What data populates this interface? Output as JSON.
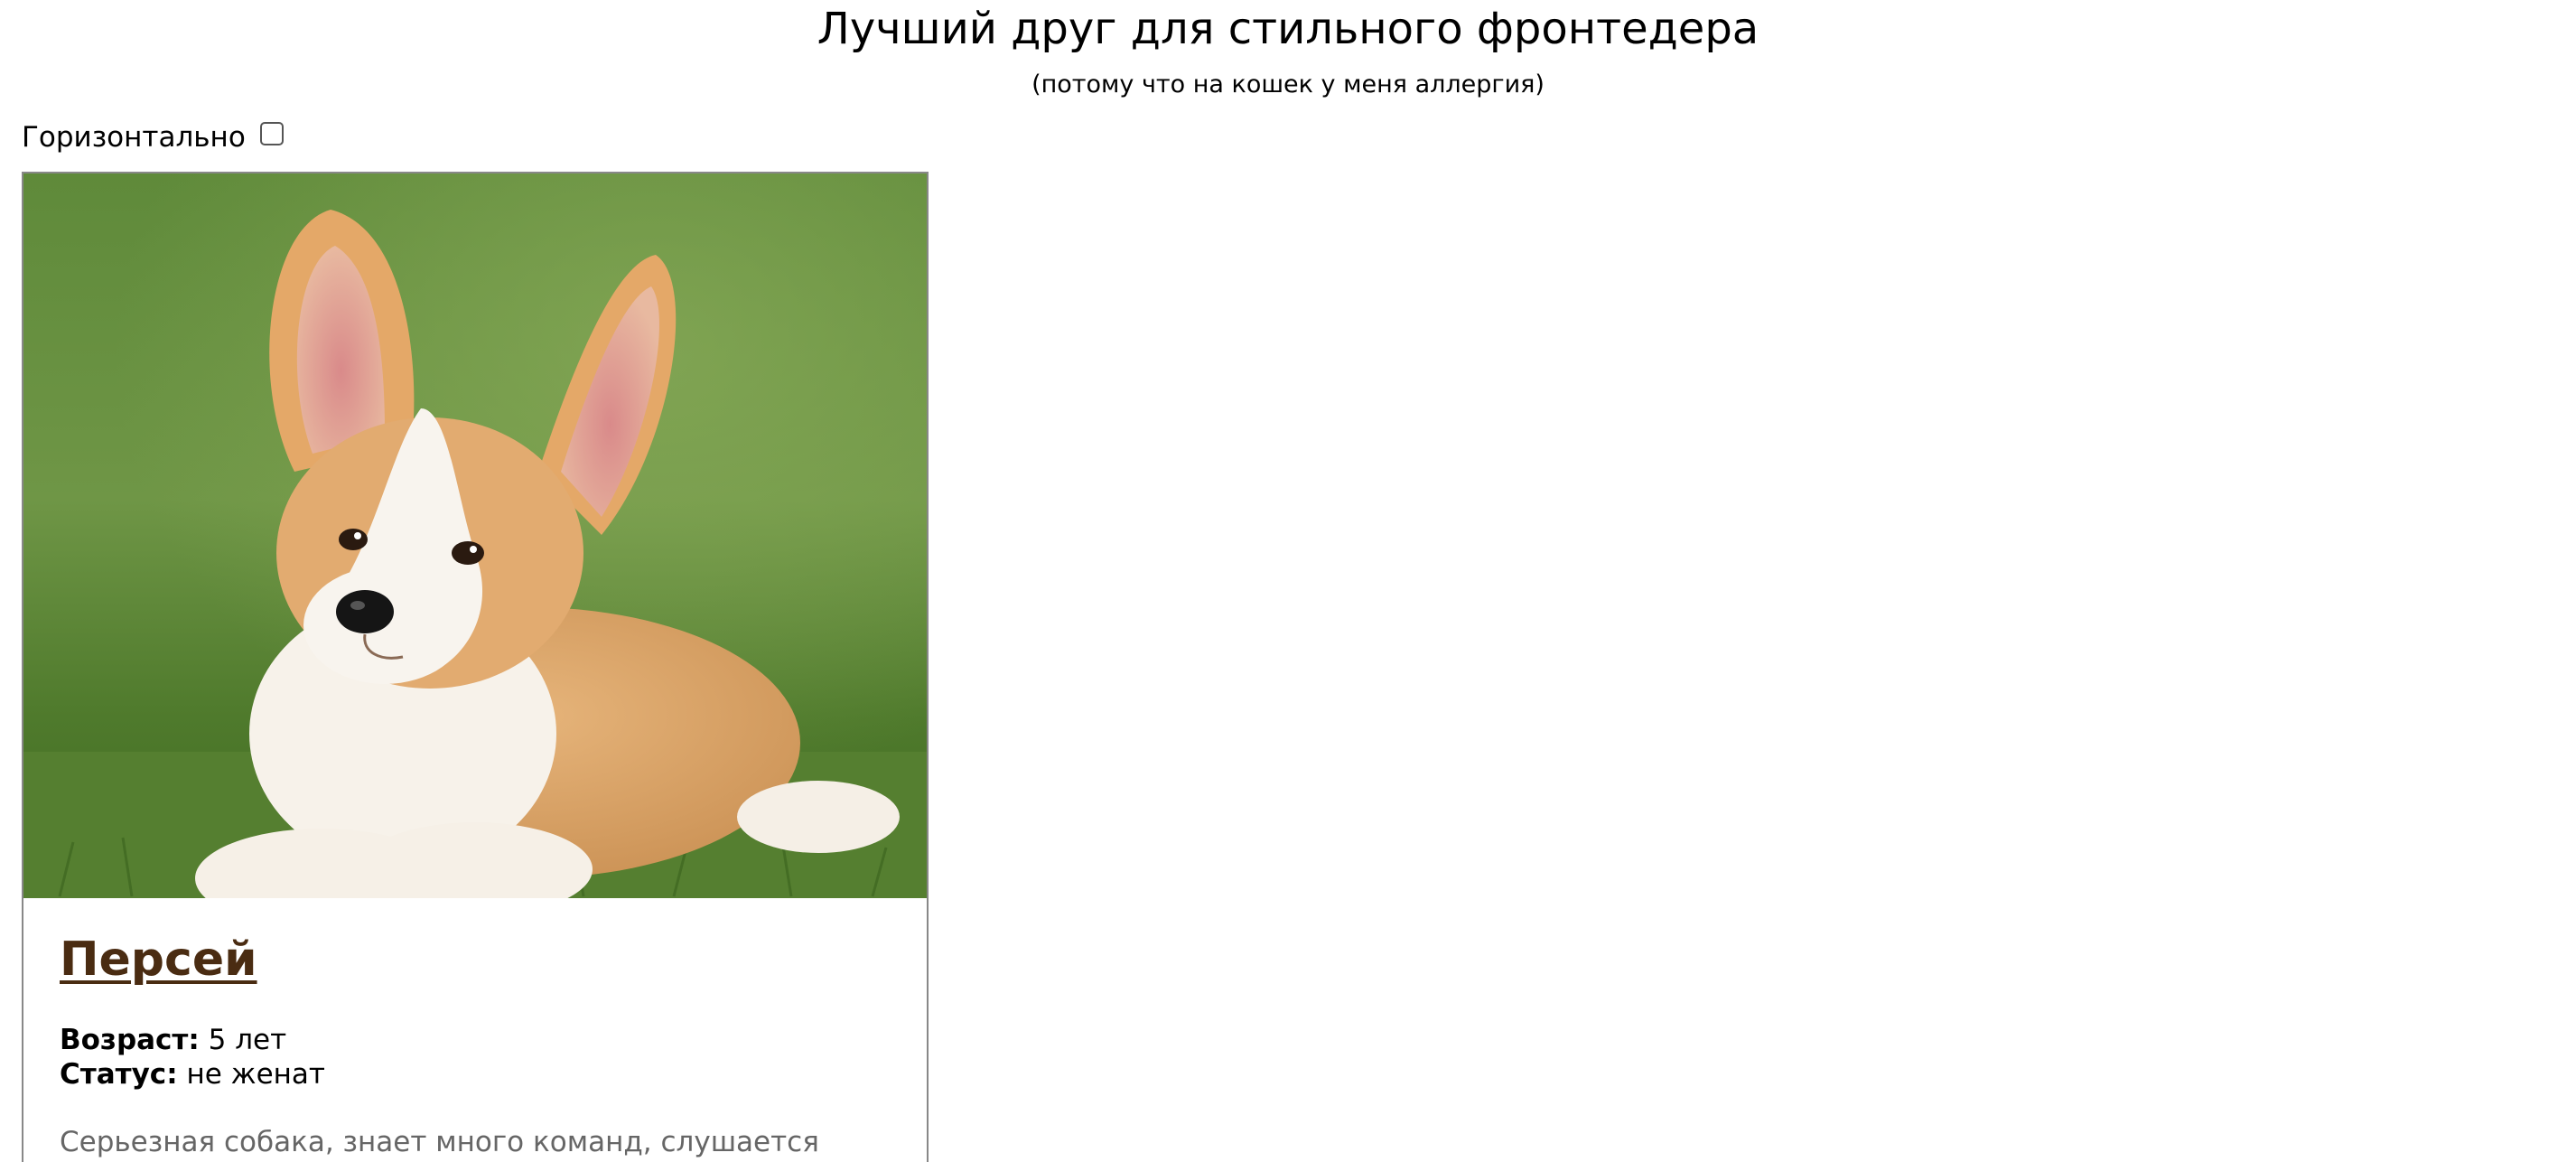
{
  "header": {
    "title": "Лучший друг для стильного фронтедера",
    "subtitle": "(потому что на кошек у меня аллергия)"
  },
  "controls": {
    "horizontal_label": "Горизонтально",
    "horizontal_checked": false
  },
  "card": {
    "image_alt": "corgi-puppy-photo",
    "name": "Персей",
    "age_label": "Возраст:",
    "age_value": "5 лет",
    "status_label": "Статус:",
    "status_value": "не женат",
    "description": "Серьезная собака, знает много команд, слушается хозяина"
  },
  "colors": {
    "name_link": "#4a2c12",
    "description_text": "#666666",
    "card_border": "#888888"
  }
}
